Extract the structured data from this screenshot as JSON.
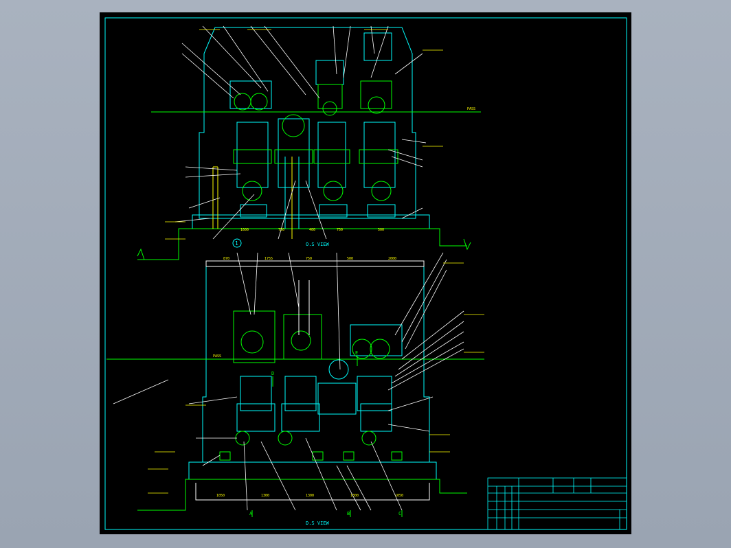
{
  "view_labels": {
    "top_view": "O.S VIEW",
    "bottom_view": "D.S VIEW"
  },
  "pass_line": {
    "upper": "PASS",
    "lower": "PASS"
  },
  "section_marks": [
    "A",
    "B",
    "C",
    "D",
    "E"
  ],
  "circle_ref": "1",
  "dims": {
    "top_row": [
      "1600",
      "750",
      "400",
      "750",
      "500"
    ],
    "bottom_row": [
      "1050",
      "1300",
      "1300",
      "1300",
      "1050"
    ],
    "lower_top": [
      "870",
      "1755",
      "750",
      "500",
      "2000"
    ]
  },
  "colors": {
    "background": "#000000",
    "page": "#a3acb9",
    "frame": "#00ffff",
    "machine": "#00ffff",
    "detail": "#00ff00",
    "leader": "#ffffff",
    "annotation": "#ffff00"
  },
  "title_block": {
    "drawing_no": "",
    "title": ""
  }
}
